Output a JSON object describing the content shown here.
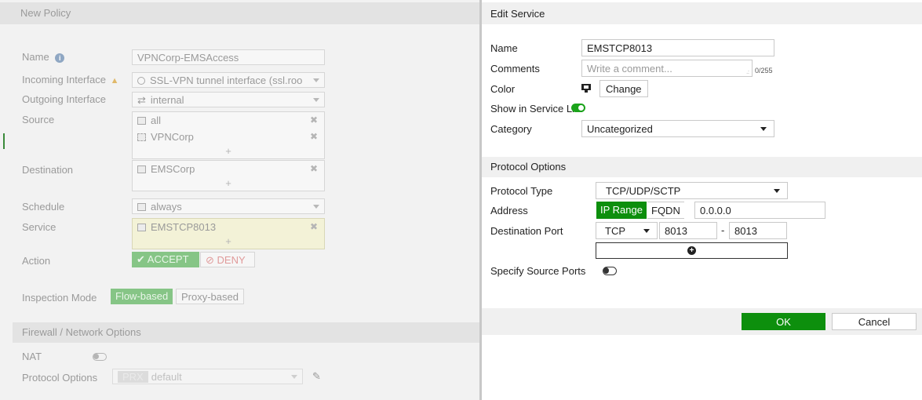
{
  "left_panel": {
    "title": "New Policy",
    "name_label": "Name",
    "name_value": "VPNCorp-EMSAccess",
    "incoming_label": "Incoming Interface",
    "incoming_value": "SSL-VPN tunnel interface (ssl.roo",
    "outgoing_label": "Outgoing Interface",
    "outgoing_value": "internal",
    "source_label": "Source",
    "source_items": [
      "all",
      "VPNCorp"
    ],
    "destination_label": "Destination",
    "destination_items": [
      "EMSCorp"
    ],
    "schedule_label": "Schedule",
    "schedule_value": "always",
    "service_label": "Service",
    "service_items": [
      "EMSTCP8013"
    ],
    "action_label": "Action",
    "accept_label": "ACCEPT",
    "deny_label": "DENY",
    "inspection_label": "Inspection Mode",
    "flow_label": "Flow-based",
    "proxy_label": "Proxy-based",
    "section_firewall": "Firewall / Network Options",
    "nat_label": "NAT",
    "protocol_options_label": "Protocol Options",
    "protocol_options_tag": "PRX",
    "protocol_options_value": "default"
  },
  "right_panel": {
    "title": "Edit Service",
    "name_label": "Name",
    "name_value": "EMSTCP8013",
    "comments_label": "Comments",
    "comments_placeholder": "Write a comment...",
    "comments_counter": "0/255",
    "color_label": "Color",
    "change_label": "Change",
    "show_in_list_label": "Show in Service List",
    "category_label": "Category",
    "category_value": "Uncategorized",
    "protocol_section": "Protocol Options",
    "protocol_type_label": "Protocol Type",
    "protocol_type_value": "TCP/UDP/SCTP",
    "address_label": "Address",
    "ip_range_label": "IP Range",
    "fqdn_label": "FQDN",
    "address_value": "0.0.0.0",
    "dest_port_label": "Destination Port",
    "port_protocol": "TCP",
    "port_low": "8013",
    "port_dash": "-",
    "port_high": "8013",
    "source_ports_label": "Specify Source Ports",
    "ok_label": "OK",
    "cancel_label": "Cancel"
  },
  "colors": {
    "accent_green": "#0d8f0d",
    "dim_green": "#86c586"
  }
}
